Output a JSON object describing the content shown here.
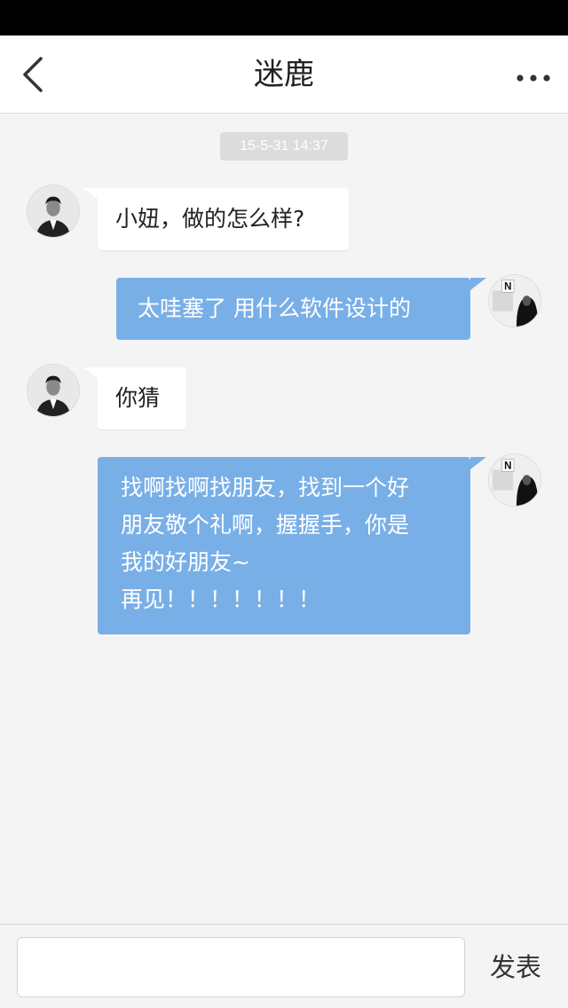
{
  "header": {
    "title": "迷鹿"
  },
  "timestamp": "15-5-31  14:37",
  "messages": [
    {
      "direction": "in",
      "text": "小妞，做的怎么样?"
    },
    {
      "direction": "out",
      "text": "太哇塞了 用什么软件设计的"
    },
    {
      "direction": "in",
      "text": "你猜"
    },
    {
      "direction": "out",
      "lines": [
        "找啊找啊找朋友，找到一个好",
        "朋友敬个礼啊，握握手，你是",
        "我的好朋友~",
        "再见！！！！！！！"
      ]
    }
  ],
  "composer": {
    "value": "",
    "send_label": "发表"
  },
  "colors": {
    "outgoing_bubble": "#79afe7",
    "incoming_bubble": "#ffffff",
    "background": "#f4f4f4"
  },
  "icons": {
    "back": "chevron-left-icon",
    "more": "ellipsis-icon"
  }
}
